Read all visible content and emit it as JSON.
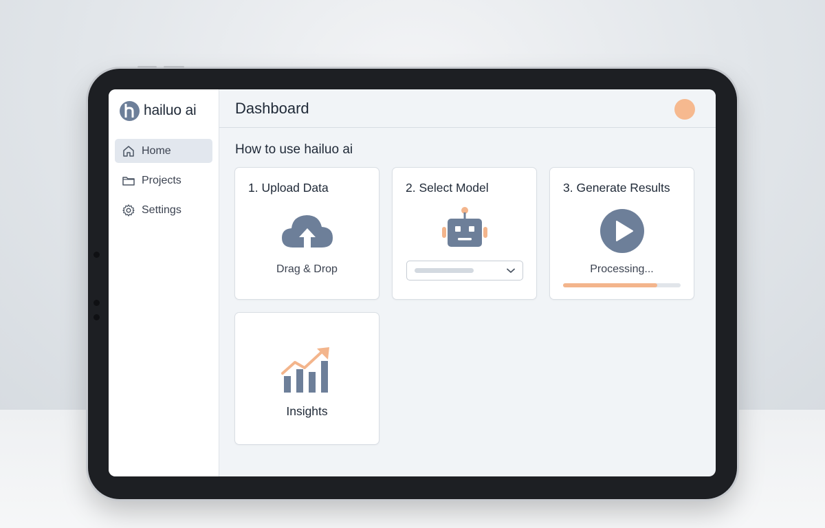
{
  "brand": {
    "name": "hailuo ai",
    "logo_icon": "h-logo-icon"
  },
  "sidebar": {
    "items": [
      {
        "label": "Home",
        "icon": "home-icon",
        "active": true
      },
      {
        "label": "Projects",
        "icon": "folder-icon",
        "active": false
      },
      {
        "label": "Settings",
        "icon": "gear-icon",
        "active": false
      }
    ]
  },
  "header": {
    "title": "Dashboard",
    "avatar_color": "#f6b98f"
  },
  "main": {
    "section_title": "How to use hailuo ai",
    "cards": [
      {
        "title": "1. Upload Data",
        "icon": "cloud-upload-icon",
        "subtitle": "Drag & Drop"
      },
      {
        "title": "2. Select Model",
        "icon": "robot-icon",
        "dropdown_value": ""
      },
      {
        "title": "3. Generate Results",
        "icon": "play-icon",
        "status": "Processing...",
        "progress": 0.8
      },
      {
        "title": "Insights",
        "icon": "growth-chart-icon"
      }
    ]
  },
  "colors": {
    "accent": "#f3b58c",
    "icon": "#6d7f99",
    "text": "#1f2937"
  }
}
